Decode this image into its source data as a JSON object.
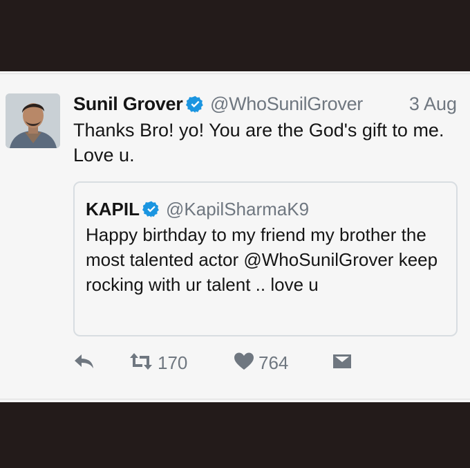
{
  "tweet": {
    "author_name": "Sunil Grover",
    "handle": "@WhoSunilGrover",
    "date": "3 Aug",
    "text": "Thanks Bro! yo! You are the God's gift to me. Love u."
  },
  "quoted_tweet": {
    "author_name": "KAPIL",
    "handle": "@KapilSharmaK9",
    "text": "Happy birthday to my friend my brother the most talented actor @WhoSunilGrover keep rocking with ur talent .. love u"
  },
  "actions": {
    "retweet_count": "170",
    "like_count": "764"
  },
  "icons": {
    "verified": "verified-badge-icon",
    "reply": "reply-icon",
    "retweet": "retweet-icon",
    "like": "heart-icon",
    "dm": "direct-message-icon"
  },
  "colors": {
    "verified_blue": "#1b95e0",
    "frame_dark": "#231b1a",
    "muted_text": "#6f7780"
  }
}
